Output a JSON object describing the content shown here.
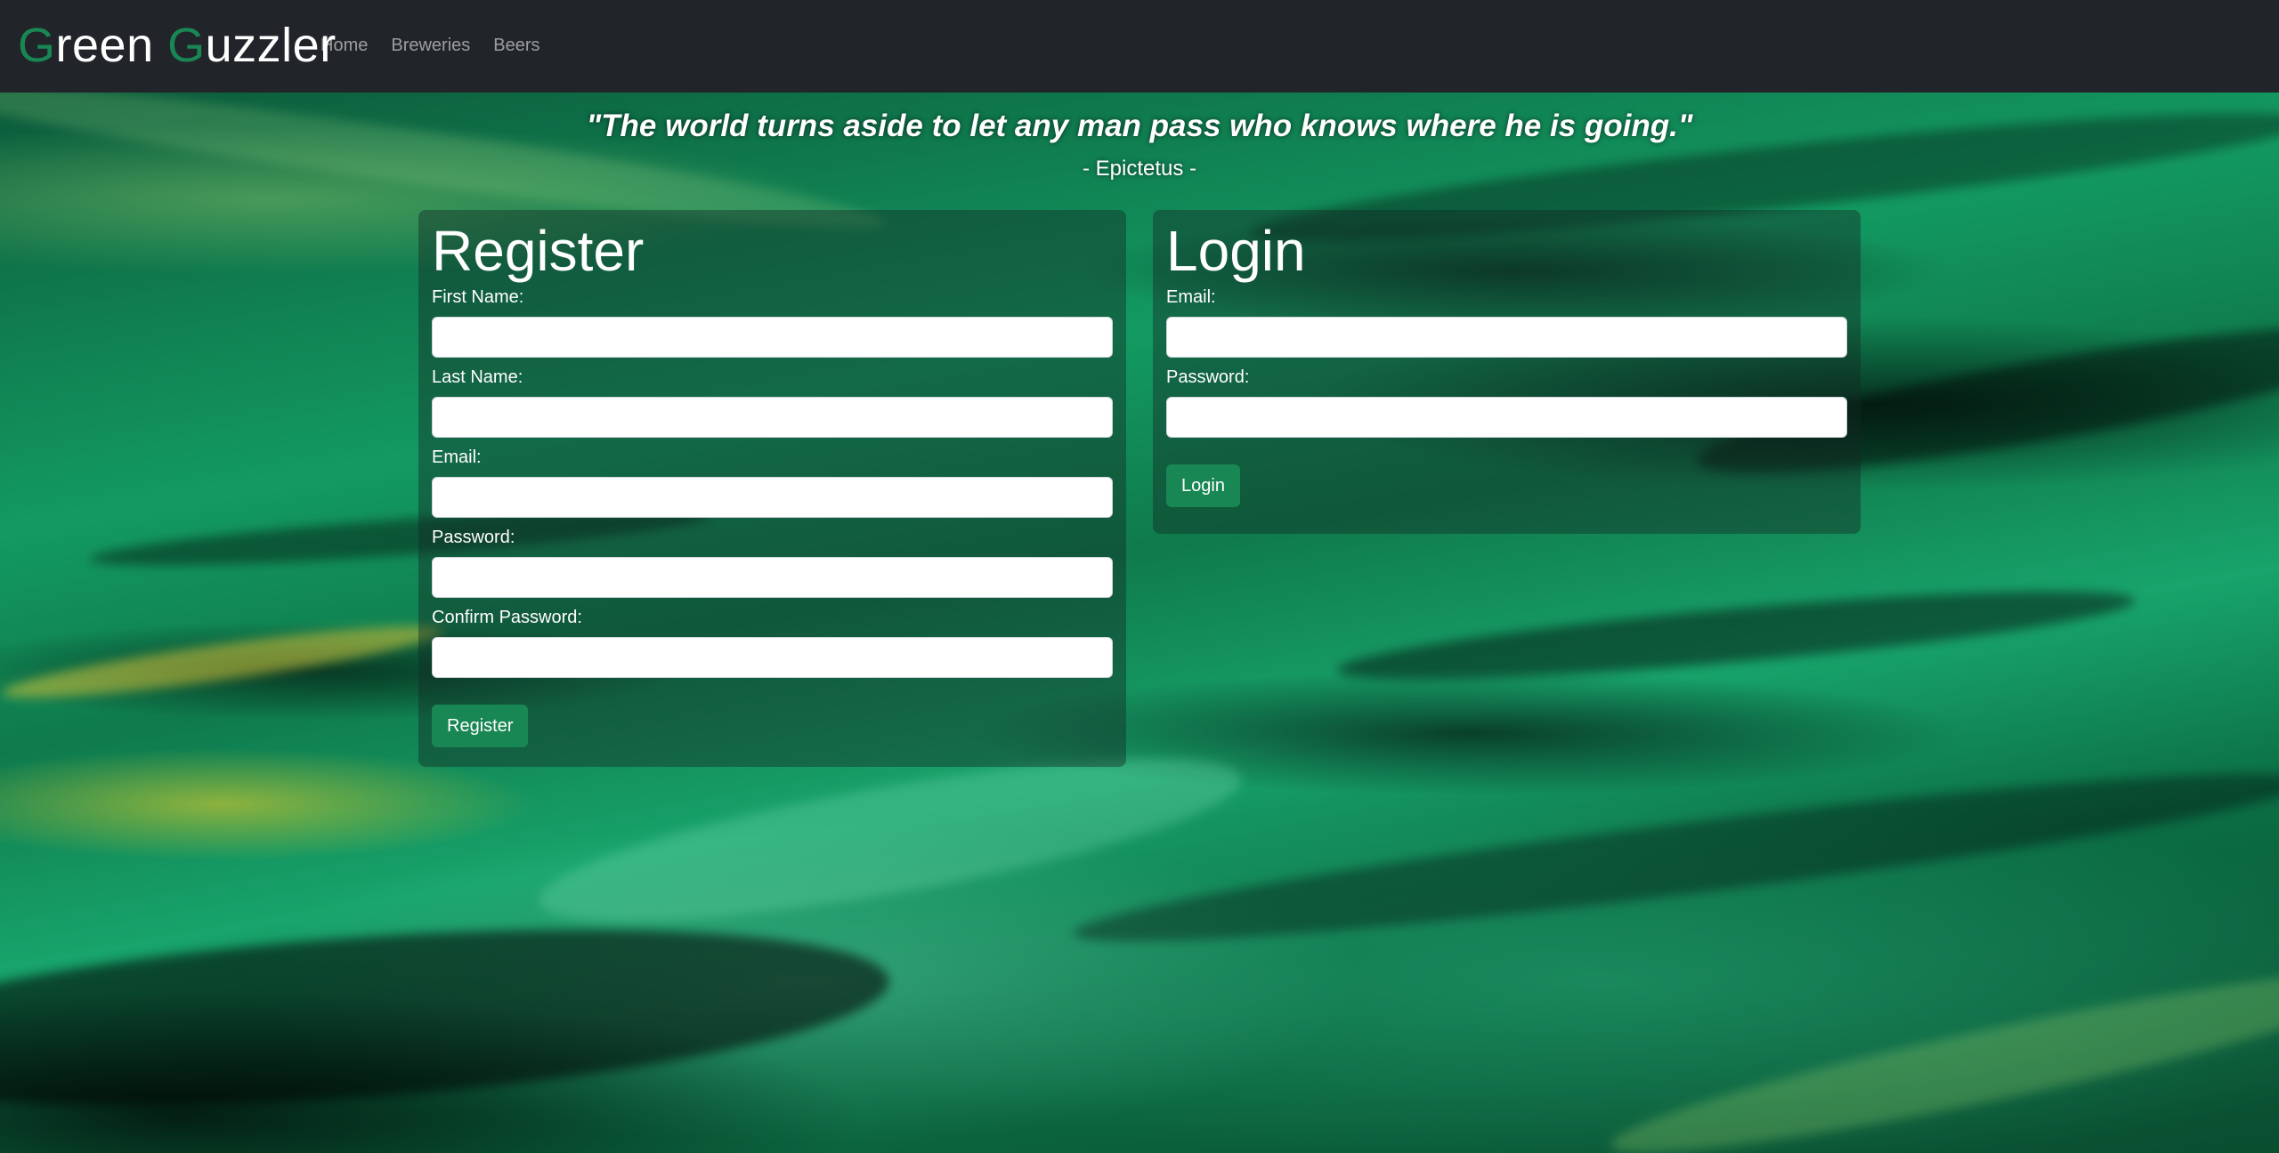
{
  "navbar": {
    "brand": {
      "first_initial": "G",
      "first_rest": "reen",
      "second_initial": "G",
      "second_rest": "uzzler"
    },
    "links": [
      {
        "label": "Home"
      },
      {
        "label": "Breweries"
      },
      {
        "label": "Beers"
      }
    ]
  },
  "hero": {
    "quote": "\"The world turns aside to let any man pass who knows where he is going.\"",
    "author": "- Epictetus -"
  },
  "register": {
    "title": "Register",
    "fields": [
      {
        "label": "First Name:",
        "value": ""
      },
      {
        "label": "Last Name:",
        "value": ""
      },
      {
        "label": "Email:",
        "value": ""
      },
      {
        "label": "Password:",
        "value": ""
      },
      {
        "label": "Confirm Password:",
        "value": ""
      }
    ],
    "button_label": "Register"
  },
  "login": {
    "title": "Login",
    "fields": [
      {
        "label": "Email:",
        "value": ""
      },
      {
        "label": "Password:",
        "value": ""
      }
    ],
    "button_label": "Login"
  },
  "colors": {
    "navbar_bg": "#212529",
    "accent_green": "#198754",
    "nav_link": "rgba(255,255,255,0.55)"
  }
}
